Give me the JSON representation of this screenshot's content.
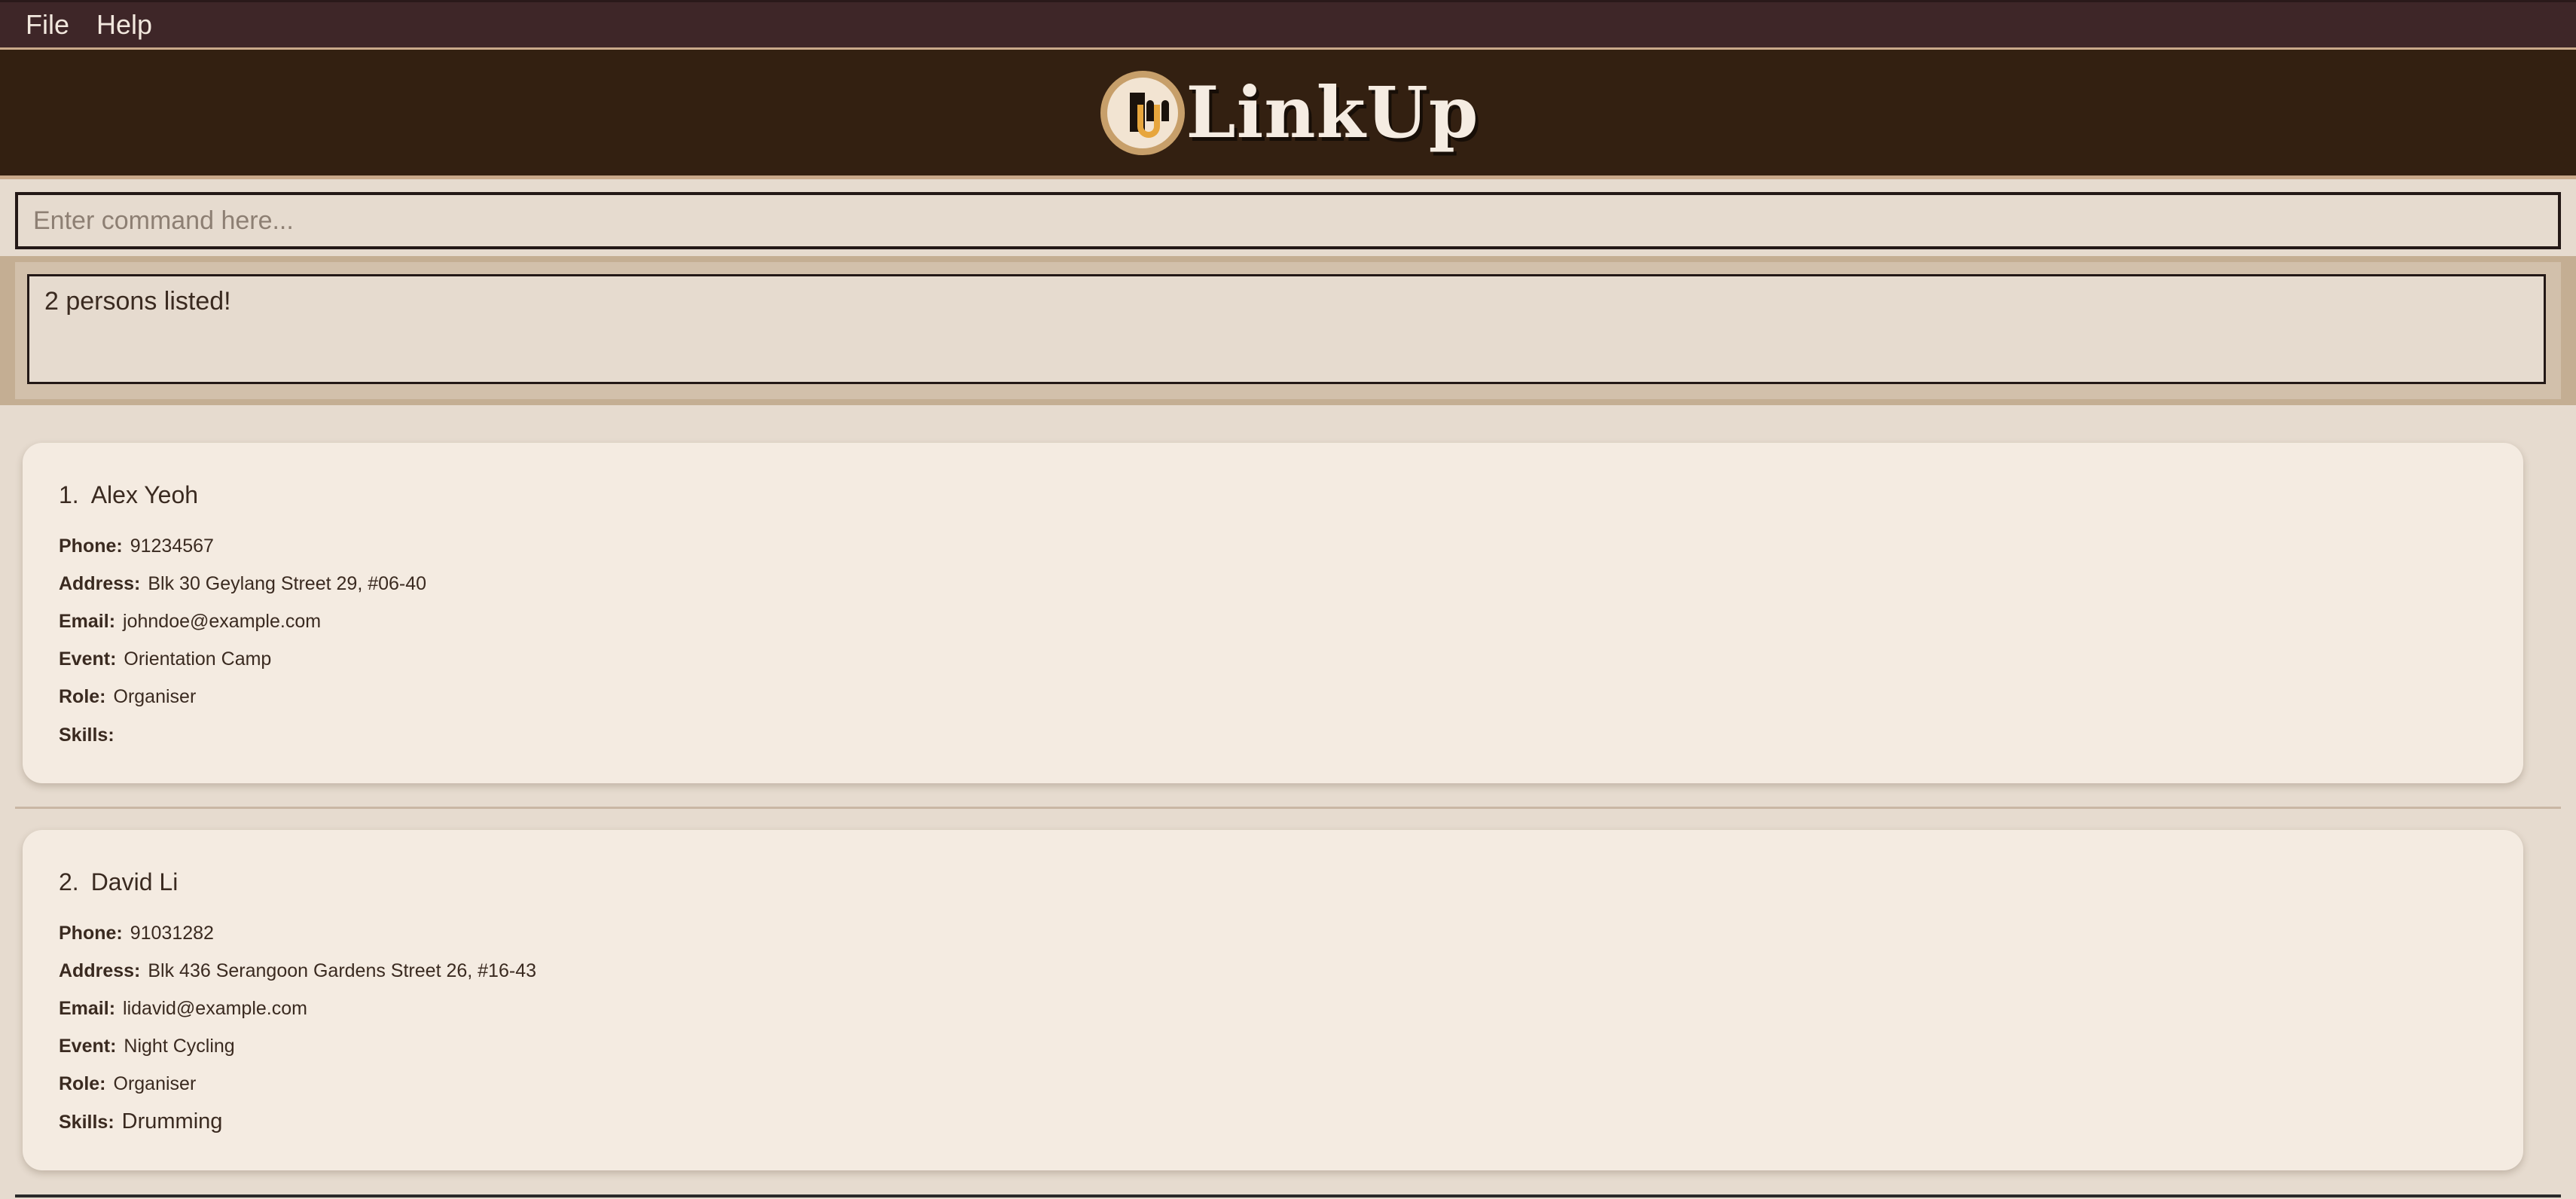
{
  "menu": {
    "file_label": "File",
    "help_label": "Help"
  },
  "header": {
    "app_name": "LinkUp",
    "logo_icon": "linkup-logo-icon"
  },
  "command": {
    "placeholder": "Enter command here...",
    "value": ""
  },
  "result": {
    "text": "2 persons listed!"
  },
  "labels": {
    "phone": "Phone:",
    "address": "Address:",
    "email": "Email:",
    "event": "Event:",
    "role": "Role:",
    "skills": "Skills:"
  },
  "persons": [
    {
      "index": "1.",
      "name": "Alex Yeoh",
      "phone": "91234567",
      "address": "Blk 30 Geylang Street 29, #06-40",
      "email": "johndoe@example.com",
      "event": "Orientation Camp",
      "role": "Organiser",
      "skills": ""
    },
    {
      "index": "2.",
      "name": "David Li",
      "phone": "91031282",
      "address": "Blk 436 Serangoon Gardens Street 26, #16-43",
      "email": "lidavid@example.com",
      "event": "Night Cycling",
      "role": "Organiser",
      "skills": "Drumming"
    }
  ],
  "colors": {
    "menubar": "#3e2628",
    "header": "#332011",
    "background": "#e6dbcf",
    "card": "#f4ebe1",
    "accent": "#c79f6a"
  }
}
